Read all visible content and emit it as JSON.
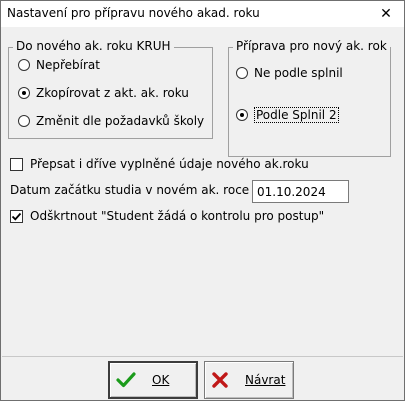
{
  "window": {
    "title": "Nastavení pro přípravu nového akad. roku",
    "close_glyph": "✕"
  },
  "group_kruh": {
    "legend": "Do nového ak. roku KRUH",
    "options": [
      {
        "label": "Nepřebírat",
        "selected": false
      },
      {
        "label": "Zkopírovat z akt. ak. roku",
        "selected": true
      },
      {
        "label": "Změnit dle požadavků školy",
        "selected": false
      }
    ]
  },
  "group_priprava": {
    "legend": "Příprava pro nový ak. rok",
    "options": [
      {
        "label": "Ne podle splnil",
        "selected": false
      },
      {
        "label": "Podle Splnil 2",
        "selected": true
      }
    ]
  },
  "overwrite_checkbox": {
    "label": "Přepsat i dříve vyplněné údaje nového ak.roku",
    "checked": false
  },
  "start_date": {
    "label": "Datum začátku studia v novém ak. roce",
    "value": "01.10.2024"
  },
  "uncheck_checkbox": {
    "label": "Odškrtnout \"Student žádá o kontrolu pro postup\"",
    "checked": true
  },
  "buttons": {
    "ok": {
      "label": "OK",
      "icon": "green-checkmark",
      "icon_color": "#1a9b1a"
    },
    "back": {
      "label": "Návrat",
      "icon": "red-cross",
      "icon_color": "#c01818"
    }
  }
}
